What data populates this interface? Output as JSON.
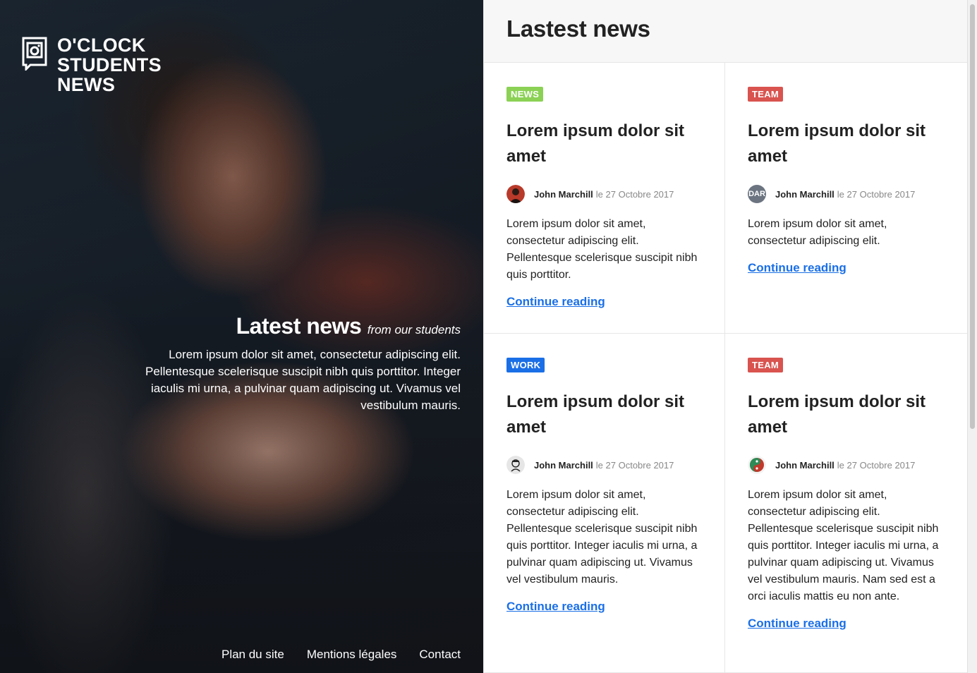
{
  "brand": {
    "lines": [
      "O'CLOCK",
      "STUDENTS",
      "NEWS"
    ],
    "icon": "camera-frame-icon"
  },
  "hero": {
    "title": "Latest news",
    "subtitle": "from our students",
    "text": "Lorem ipsum dolor sit amet, consectetur adipiscing elit. Pellentesque scelerisque suscipit nibh quis porttitor. Integer iaculis mi urna, a pulvinar quam adipiscing ut. Vivamus vel vestibulum mauris."
  },
  "footer": {
    "links": [
      "Plan du site",
      "Mentions légales",
      "Contact"
    ]
  },
  "main": {
    "heading": "Lastest news",
    "articles": [
      {
        "tag": "NEWS",
        "tag_color": "#8bd155",
        "title": "Lorem ipsum dolor sit amet",
        "author": "John Marchill",
        "date": "le 27 Octobre 2017",
        "avatar_color": "#b83a2a",
        "excerpt": "Lorem ipsum dolor sit amet, consectetur adipiscing elit. Pellentesque scelerisque suscipit nibh quis porttitor.",
        "link": "Continue reading"
      },
      {
        "tag": "TEAM",
        "tag_color": "#d9534f",
        "title": "Lorem ipsum dolor sit amet",
        "author": "John Marchill",
        "date": "le 27 Octobre 2017",
        "avatar_color": "#6b7480",
        "avatar_text": "DAR",
        "excerpt": "Lorem ipsum dolor sit amet, consectetur adipiscing elit.",
        "link": "Continue reading"
      },
      {
        "tag": "WORK",
        "tag_color": "#1a6fe6",
        "title": "Lorem ipsum dolor sit amet",
        "author": "John Marchill",
        "date": "le 27 Octobre 2017",
        "avatar_color": "#dcdcdc",
        "excerpt": "Lorem ipsum dolor sit amet, consectetur adipiscing elit. Pellentesque scelerisque suscipit nibh quis porttitor. Integer iaculis mi urna, a pulvinar quam adipiscing ut. Vivamus vel vestibulum mauris.",
        "link": "Continue reading"
      },
      {
        "tag": "TEAM",
        "tag_color": "#d9534f",
        "title": "Lorem ipsum dolor sit amet",
        "author": "John Marchill",
        "date": "le 27 Octobre 2017",
        "avatar_color": "#c0392b",
        "excerpt": "Lorem ipsum dolor sit amet, consectetur adipiscing elit. Pellentesque scelerisque suscipit nibh quis porttitor. Integer iaculis mi urna, a pulvinar quam adipiscing ut. Vivamus vel vestibulum mauris. Nam sed est a orci iaculis mattis eu non ante.",
        "link": "Continue reading"
      }
    ]
  },
  "colors": {
    "link": "#1a6fe6",
    "header_bg": "#f7f7f7"
  }
}
